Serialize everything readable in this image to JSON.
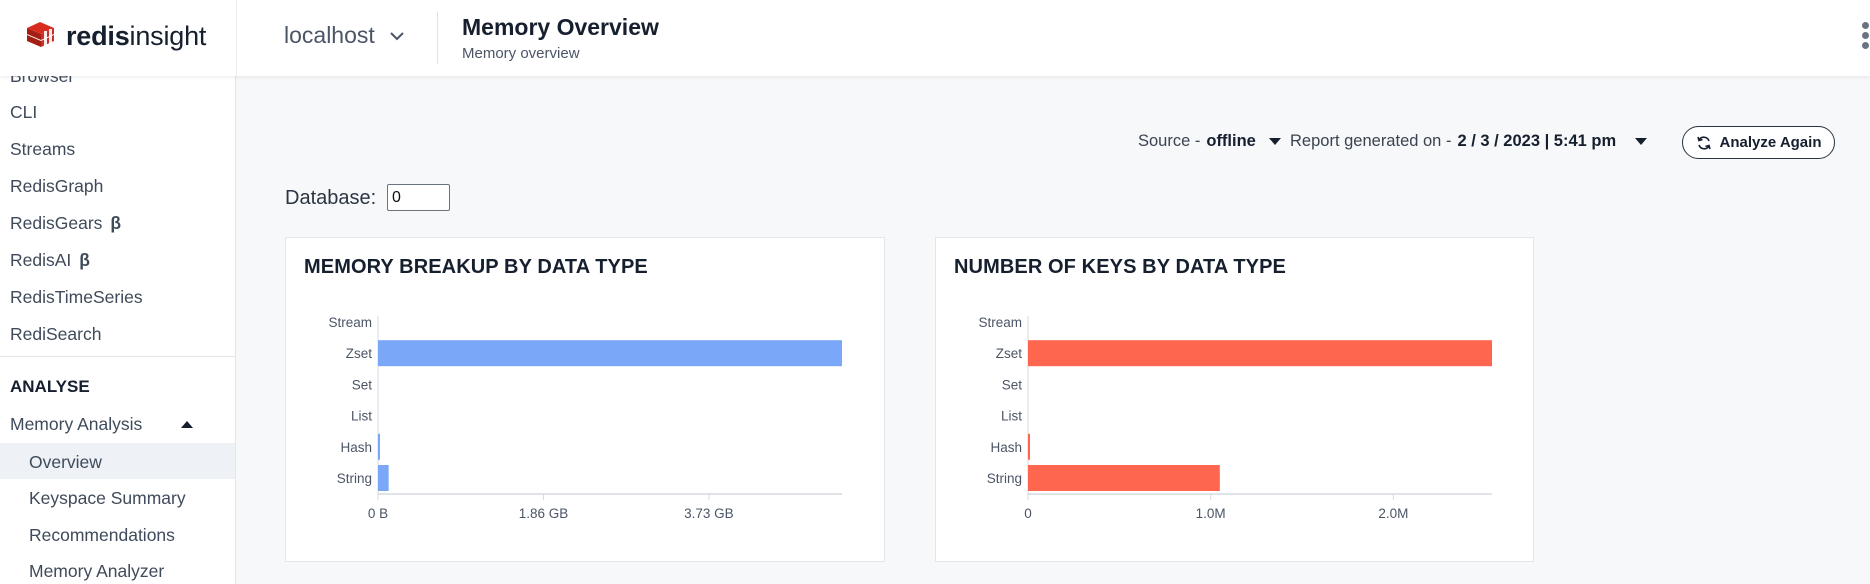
{
  "app": {
    "logo_bold": "redis",
    "logo_normal": "insight",
    "database": "localhost",
    "page_title": "Memory Overview",
    "page_subtitle": "Memory overview"
  },
  "sidebar": {
    "items": [
      {
        "label": "Browser"
      },
      {
        "label": "CLI"
      },
      {
        "label": "Streams"
      },
      {
        "label": "RedisGraph"
      },
      {
        "label": "RedisGears",
        "badge": "β"
      },
      {
        "label": "RedisAI",
        "badge": "β"
      },
      {
        "label": "RedisTimeSeries"
      },
      {
        "label": "RediSearch"
      }
    ],
    "section": "ANALYSE",
    "group": "Memory Analysis",
    "sub_items": [
      {
        "label": "Overview",
        "active": true
      },
      {
        "label": "Keyspace Summary"
      },
      {
        "label": "Recommendations"
      },
      {
        "label": "Memory Analyzer"
      }
    ]
  },
  "toolbar": {
    "source_label": "Source -",
    "source_value": "offline",
    "report_label": "Report generated on -",
    "report_value": "2 / 3 / 2023 | 5:41 pm",
    "analyze_label": "Analyze Again"
  },
  "database_field": {
    "label": "Database:",
    "value": "0"
  },
  "colors": {
    "memory_bar": "#7aa7f7",
    "keys_bar": "#ff6650",
    "logo_red": "#d82c20"
  },
  "chart_data": [
    {
      "type": "bar",
      "orientation": "horizontal",
      "title": "MEMORY BREAKUP BY DATA TYPE",
      "categories": [
        "Stream",
        "Zset",
        "Set",
        "List",
        "Hash",
        "String"
      ],
      "values": [
        0,
        5.23,
        0,
        0,
        0.004,
        0.12
      ],
      "unit": "GB",
      "xticks": [
        "0 B",
        "1.86 GB",
        "3.73 GB"
      ],
      "xtick_values": [
        0,
        1.865,
        3.73
      ],
      "xlim": [
        0,
        5.23
      ]
    },
    {
      "type": "bar",
      "orientation": "horizontal",
      "title": "NUMBER OF KEYS BY DATA TYPE",
      "categories": [
        "Stream",
        "Zset",
        "Set",
        "List",
        "Hash",
        "String"
      ],
      "values": [
        0,
        2540000,
        0,
        0,
        5000,
        1050000
      ],
      "xticks": [
        "0",
        "1.0M",
        "2.0M"
      ],
      "xtick_values": [
        0,
        1000000,
        2000000
      ],
      "xlim": [
        0,
        2540000
      ]
    }
  ]
}
